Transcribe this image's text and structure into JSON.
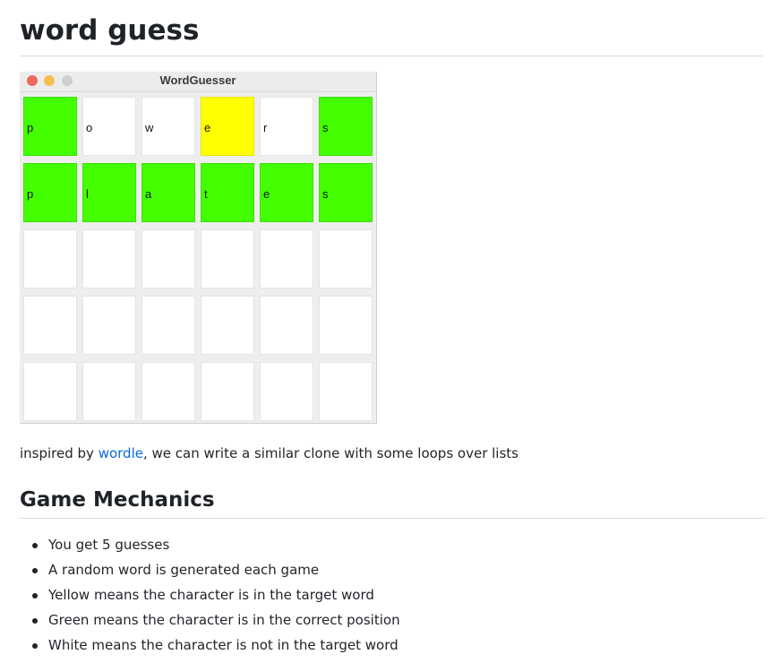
{
  "page": {
    "title": "word guess",
    "intro_before": "inspired by ",
    "intro_link": "wordle",
    "intro_after": ", we can write a similar clone with some loops over lists",
    "section_title": "Game Mechanics",
    "mechanics": [
      "You get 5 guesses",
      "A random word is generated each game",
      "Yellow means the character is in the target word",
      "Green means the character is in the correct position",
      "White means the character is not in the target word"
    ]
  },
  "window": {
    "title": "WordGuesser"
  },
  "board": {
    "rows": [
      [
        {
          "letter": "p",
          "state": "green"
        },
        {
          "letter": "o",
          "state": "white"
        },
        {
          "letter": "w",
          "state": "white"
        },
        {
          "letter": "e",
          "state": "yellow"
        },
        {
          "letter": "r",
          "state": "white"
        },
        {
          "letter": "s",
          "state": "green"
        }
      ],
      [
        {
          "letter": "p",
          "state": "green"
        },
        {
          "letter": "l",
          "state": "green"
        },
        {
          "letter": "a",
          "state": "green"
        },
        {
          "letter": "t",
          "state": "green"
        },
        {
          "letter": "e",
          "state": "green"
        },
        {
          "letter": "s",
          "state": "green"
        }
      ],
      [
        {
          "letter": "",
          "state": "white"
        },
        {
          "letter": "",
          "state": "white"
        },
        {
          "letter": "",
          "state": "white"
        },
        {
          "letter": "",
          "state": "white"
        },
        {
          "letter": "",
          "state": "white"
        },
        {
          "letter": "",
          "state": "white"
        }
      ],
      [
        {
          "letter": "",
          "state": "white"
        },
        {
          "letter": "",
          "state": "white"
        },
        {
          "letter": "",
          "state": "white"
        },
        {
          "letter": "",
          "state": "white"
        },
        {
          "letter": "",
          "state": "white"
        },
        {
          "letter": "",
          "state": "white"
        }
      ],
      [
        {
          "letter": "",
          "state": "white"
        },
        {
          "letter": "",
          "state": "white"
        },
        {
          "letter": "",
          "state": "white"
        },
        {
          "letter": "",
          "state": "white"
        },
        {
          "letter": "",
          "state": "white"
        },
        {
          "letter": "",
          "state": "white"
        }
      ]
    ]
  },
  "colors": {
    "green": "#44ff00",
    "yellow": "#ffff00",
    "white": "#ffffff",
    "link": "#0969da"
  }
}
